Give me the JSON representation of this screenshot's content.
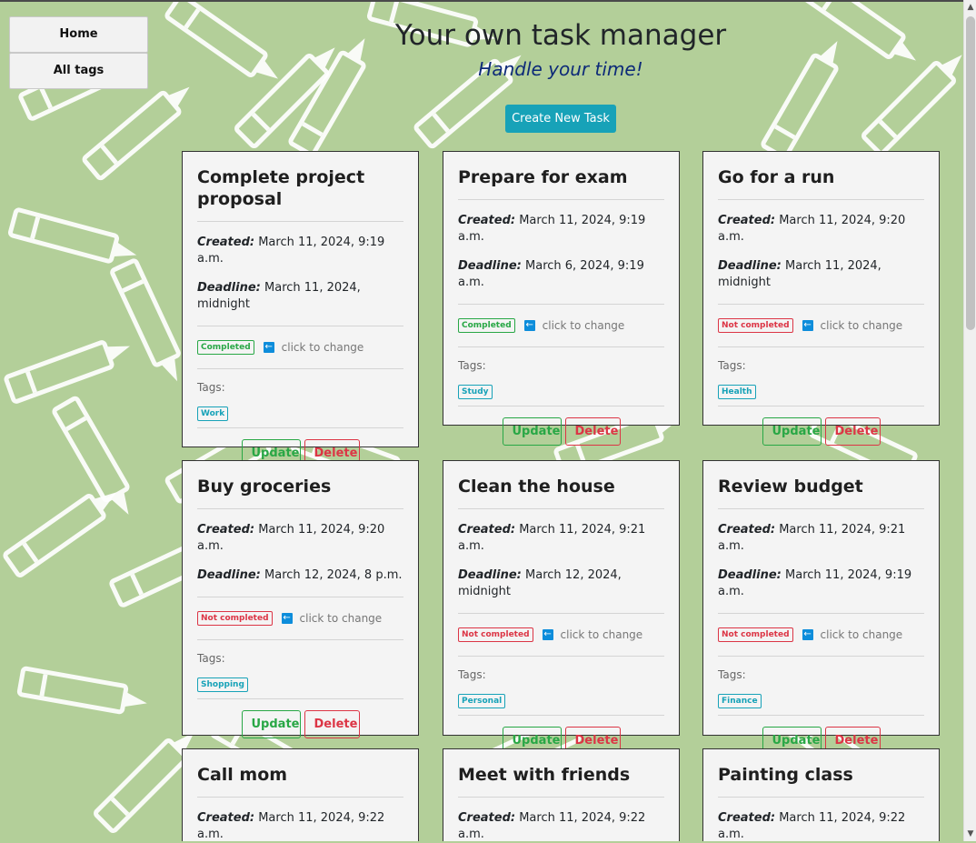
{
  "nav": {
    "home": "Home",
    "all_tags": "All tags"
  },
  "header": {
    "title": "Your own task manager",
    "subtitle": "Handle your time!",
    "create": "Create New Task"
  },
  "colors": {
    "background": "#b3cf99",
    "accent": "#17a2b8",
    "success": "#28a745",
    "danger": "#dc3545"
  },
  "labels": {
    "created": "Created:",
    "deadline": "Deadline:",
    "click_to_change": "click to change",
    "tags": "Tags:",
    "update": "Update",
    "delete": "Delete"
  },
  "tasks": [
    {
      "title": "Complete project proposal",
      "created": "March 11, 2024, 9:19 a.m.",
      "deadline": "March 11, 2024, midnight",
      "status": "Completed",
      "tag": "Work"
    },
    {
      "title": "Prepare for exam",
      "created": "March 11, 2024, 9:19 a.m.",
      "deadline": "March 6, 2024, 9:19 a.m.",
      "status": "Completed",
      "tag": "Study"
    },
    {
      "title": "Go for a run",
      "created": "March 11, 2024, 9:20 a.m.",
      "deadline": "March 11, 2024, midnight",
      "status": "Not completed",
      "tag": "Health"
    },
    {
      "title": "Buy groceries",
      "created": "March 11, 2024, 9:20 a.m.",
      "deadline": "March 12, 2024, 8 p.m.",
      "status": "Not completed",
      "tag": "Shopping"
    },
    {
      "title": "Clean the house",
      "created": "March 11, 2024, 9:21 a.m.",
      "deadline": "March 12, 2024, midnight",
      "status": "Not completed",
      "tag": "Personal"
    },
    {
      "title": "Review budget",
      "created": "March 11, 2024, 9:21 a.m.",
      "deadline": "March 11, 2024, 9:19 a.m.",
      "status": "Not completed",
      "tag": "Finance"
    },
    {
      "title": "Call mom",
      "created": "March 11, 2024, 9:22 a.m."
    },
    {
      "title": "Meet with friends",
      "created": "March 11, 2024, 9:22 a.m."
    },
    {
      "title": "Painting class",
      "created": "March 11, 2024, 9:22 a.m."
    }
  ]
}
